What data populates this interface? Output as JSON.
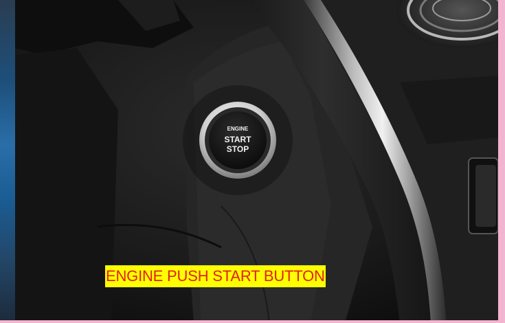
{
  "photo": {
    "subject": "car dashboard with keyless ignition button",
    "button_text": {
      "line1": "ENGINE",
      "line2": "START",
      "line3": "STOP"
    }
  },
  "caption": {
    "text": "ENGINE PUSH START BUTTON",
    "text_color": "#e0201a",
    "background_color": "#ffff00"
  },
  "colors": {
    "frame_pink": "#f3b4cf",
    "chrome_ring": "#dcdcdc",
    "button_face": "#141414"
  }
}
